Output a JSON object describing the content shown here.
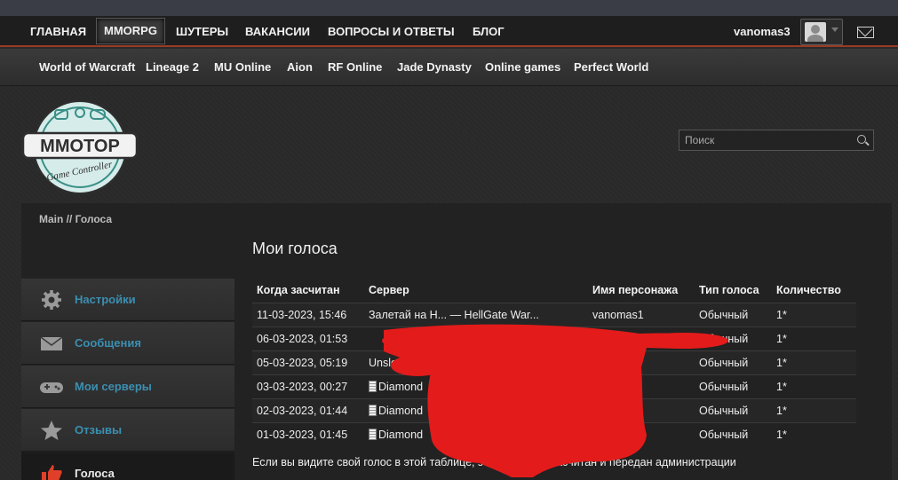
{
  "top_nav": {
    "items": [
      "ГЛАВНАЯ",
      "MMORPG",
      "ШУТЕРЫ",
      "ВАКАНСИИ",
      "ВОПРОСЫ И ОТВЕТЫ",
      "БЛОГ"
    ],
    "active": "MMORPG",
    "username": "vanomas3",
    "icons": [
      "avatar-icon",
      "mail-icon"
    ]
  },
  "sub_nav": {
    "items": [
      "World of Warcraft",
      "Lineage 2",
      "MU Online",
      "Aion",
      "RF Online",
      "Jade Dynasty",
      "Online games",
      "Perfect World"
    ]
  },
  "logo": {
    "title": "MMOTOP",
    "subtitle": "Game Controller"
  },
  "search": {
    "placeholder": "Поиск"
  },
  "breadcrumb": "Main // Голоса",
  "page_title": "Мои голоса",
  "sidebar": {
    "items": [
      {
        "label": "Настройки",
        "icon": "gear-icon"
      },
      {
        "label": "Сообщения",
        "icon": "envelope-icon"
      },
      {
        "label": "Мои серверы",
        "icon": "gamepad-icon"
      },
      {
        "label": "Отзывы",
        "icon": "star-icon"
      },
      {
        "label": "Голоса",
        "icon": "thumb-icon"
      }
    ]
  },
  "table": {
    "headers": [
      "Когда засчитан",
      "Сервер",
      "Имя персонажа",
      "Тип голоса",
      "Количество"
    ],
    "rows": [
      {
        "date": "11-03-2023, 15:46",
        "server": "Залетай на H... — HellGate War...",
        "character": "vanomas1",
        "type": "Обычный",
        "count": "1*"
      },
      {
        "date": "06-03-2023, 01:53",
        "server": "",
        "character": "",
        "type": "Обычный",
        "count": "1*"
      },
      {
        "date": "05-03-2023, 05:19",
        "server": "Unsle",
        "character": "",
        "type": "Обычный",
        "count": "1*"
      },
      {
        "date": "03-03-2023, 00:27",
        "server": "Diamond",
        "character": "",
        "type": "Обычный",
        "count": "1*"
      },
      {
        "date": "02-03-2023, 01:44",
        "server": "Diamond",
        "character": "",
        "type": "Обычный",
        "count": "1*"
      },
      {
        "date": "01-03-2023, 01:45",
        "server": "Diamond",
        "character": "",
        "type": "Обычный",
        "count": "1*"
      }
    ]
  },
  "note": "Если вы видите свой голос в этой таблице, з           ыл успешно засчитан и передан администрации",
  "colors": {
    "accent_border": "#9a3a22",
    "sidebar_link": "#3b8fb1",
    "redaction": "#e31b1b"
  }
}
